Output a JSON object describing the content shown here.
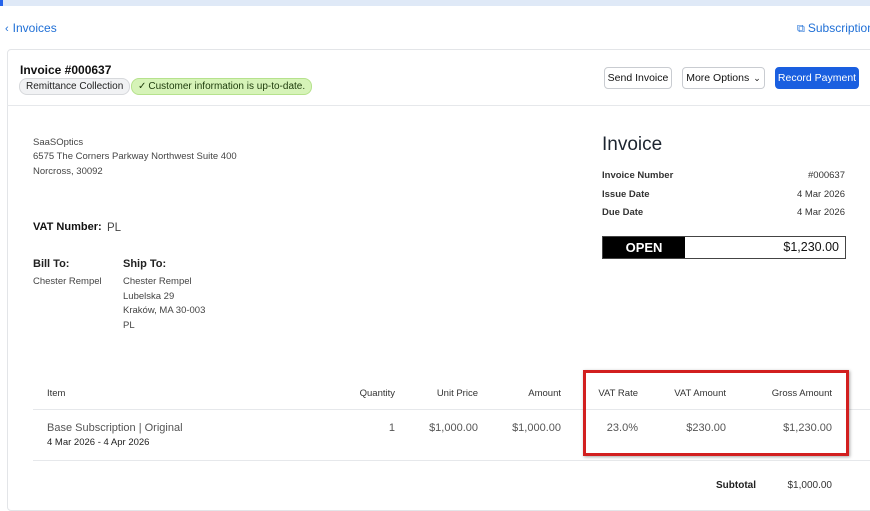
{
  "nav": {
    "back_label": "Invoices",
    "subscription_label": "Subscription"
  },
  "header": {
    "invoice_title": "Invoice #000637",
    "badge_type": "Remittance Collection",
    "badge_customer": "Customer information is up-to-date.",
    "send_invoice": "Send Invoice",
    "more_options": "More Options",
    "record_payment": "Record Payment"
  },
  "company": {
    "name": "SaaSOptics",
    "address1": "6575 The Corners Parkway Northwest Suite 400",
    "address2": "Norcross, 30092",
    "vat_label": "VAT Number:",
    "vat_value": "PL"
  },
  "bill_to": {
    "label": "Bill To:",
    "name": "Chester Rempel"
  },
  "ship_to": {
    "label": "Ship To:",
    "name": "Chester Rempel",
    "street": "Lubelska 29",
    "city": "Kraków, MA 30-003",
    "country": "PL"
  },
  "invoice": {
    "heading": "Invoice",
    "number_label": "Invoice Number",
    "number": "#000637",
    "issue_label": "Issue Date",
    "issue_date": "4 Mar 2026",
    "due_label": "Due Date",
    "due_date": "4 Mar 2026",
    "status": "OPEN",
    "total": "$1,230.00"
  },
  "table": {
    "columns": {
      "item": "Item",
      "quantity": "Quantity",
      "unit_price": "Unit Price",
      "amount": "Amount",
      "vat_rate": "VAT Rate",
      "vat_amount": "VAT Amount",
      "gross_amount": "Gross Amount"
    },
    "rows": [
      {
        "item": "Base Subscription | Original",
        "period": "4 Mar 2026 - 4 Apr 2026",
        "quantity": "1",
        "unit_price": "$1,000.00",
        "amount": "$1,000.00",
        "vat_rate": "23.0%",
        "vat_amount": "$230.00",
        "gross_amount": "$1,230.00"
      }
    ]
  },
  "totals": {
    "subtotal_label": "Subtotal",
    "subtotal": "$1,000.00"
  },
  "colors": {
    "primary": "#1a5fe0",
    "link": "#1f6fd6",
    "highlight": "#d21f1f",
    "badge_green": "#d6f3b8"
  }
}
